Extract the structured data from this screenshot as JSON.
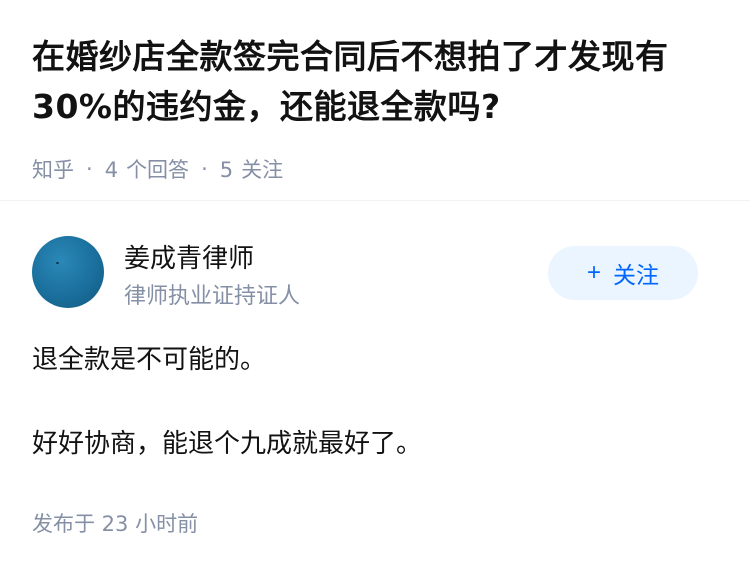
{
  "question": {
    "title": "在婚纱店全款签完合同后不想拍了才发现有30%的违约金，还能退全款吗?",
    "meta": {
      "source": "知乎",
      "separator": "·",
      "answers_count": "4",
      "answers_label": "个回答",
      "followers_count": "5",
      "followers_label": "关注"
    }
  },
  "answer": {
    "author": {
      "name": "姜成青律师",
      "badge": "律师执业证持证人"
    },
    "follow_button": {
      "icon": "plus-icon",
      "icon_glyph": "+",
      "label": "关注"
    },
    "paragraphs": [
      "退全款是不可能的。",
      "好好协商，能退个九成就最好了。"
    ],
    "published": "发布于 23 小时前"
  },
  "colors": {
    "text_primary": "#121212",
    "text_secondary": "#8590a6",
    "accent": "#0066ff",
    "accent_bg": "#ebf5ff",
    "avatar": "#1a6f9c"
  }
}
